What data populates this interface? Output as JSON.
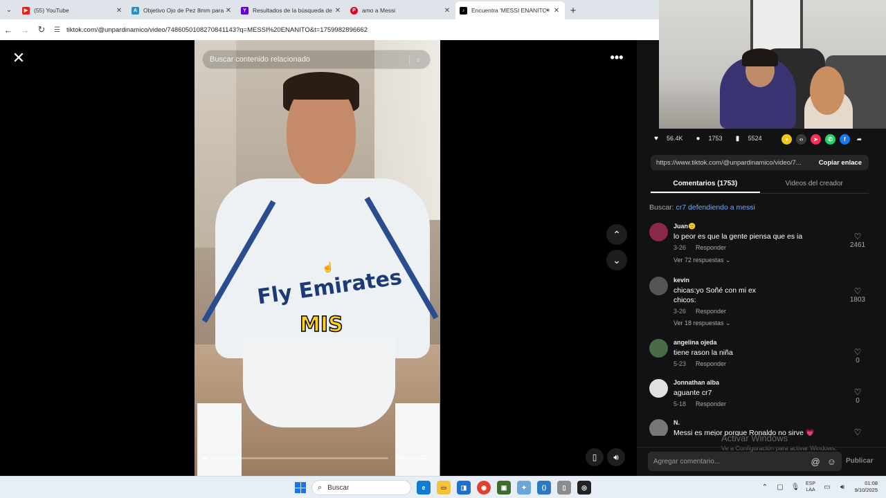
{
  "browser": {
    "tabs": [
      {
        "title": "(55) YouTube",
        "favicon": "youtube-icon",
        "color": "#e62117"
      },
      {
        "title": "Objetivo Ojo de Pez 8mm para",
        "favicon": "ae-icon",
        "color": "#2a8fbd"
      },
      {
        "title": "Resultados de la búsqueda de",
        "favicon": "yahoo-icon",
        "color": "#5f01d1"
      },
      {
        "title": "amo a Messi",
        "favicon": "pinterest-icon",
        "color": "#e60023"
      },
      {
        "title": "Encuentra 'MESSI ENANITO",
        "favicon": "tiktok-icon",
        "color": "#000000"
      }
    ],
    "url": "tiktok.com/@unpardinamico/video/7486050108270841143?q=MESSI%20ENANITO&t=1759982896662"
  },
  "video": {
    "search_placeholder": "Buscar contenido relacionado",
    "caption_overlay": "MIS",
    "sponsor_text": "Fly Emirates",
    "time": "00:01/00:32",
    "progress": 0.03
  },
  "panel": {
    "stats": {
      "likes": "56.4K",
      "comments": "1753",
      "saves": "5524"
    },
    "link_url": "https://www.tiktok.com/@unpardinamico/video/7...",
    "copy_label": "Copiar enlace",
    "tabs": [
      "Comentarios (1753)",
      "Videos del creador"
    ],
    "search_prefix": "Buscar:",
    "search_keyword": "cr7 defendiendo a messi",
    "comments": [
      {
        "name": "Juan🙂",
        "text": "lo peor es que la gente piensa que es ia",
        "date": "3-26",
        "reply": "Responder",
        "more": "Ver 72 respuestas ⌄",
        "likes": "2461"
      },
      {
        "name": "kevin",
        "text": "chicas:yo Soñé con mi ex chicos:",
        "date": "3-26",
        "reply": "Responder",
        "more": "Ver 18 respuestas ⌄",
        "likes": "1803"
      },
      {
        "name": "angelina ojeda",
        "text": "tiene rason la niña",
        "date": "5-23",
        "reply": "Responder",
        "more": "",
        "likes": "0"
      },
      {
        "name": "Jonnathan alba",
        "text": "aguante cr7",
        "date": "5-18",
        "reply": "Responder",
        "more": "",
        "likes": "0"
      },
      {
        "name": "N.",
        "text": "Messi es mejor porque Ronaldo no sirve 💗",
        "date": "",
        "reply": "",
        "more": "",
        "likes": ""
      }
    ],
    "compose_placeholder": "Agregar comentario...",
    "post_label": "Publicar",
    "watermark_title": "Activar Windows",
    "watermark_sub": "Ve a Configuración para activar Windows."
  },
  "taskbar": {
    "search_label": "Buscar",
    "lang": "ESP",
    "layout": "LAA",
    "time": "01:08",
    "date": "9/10/2025"
  }
}
